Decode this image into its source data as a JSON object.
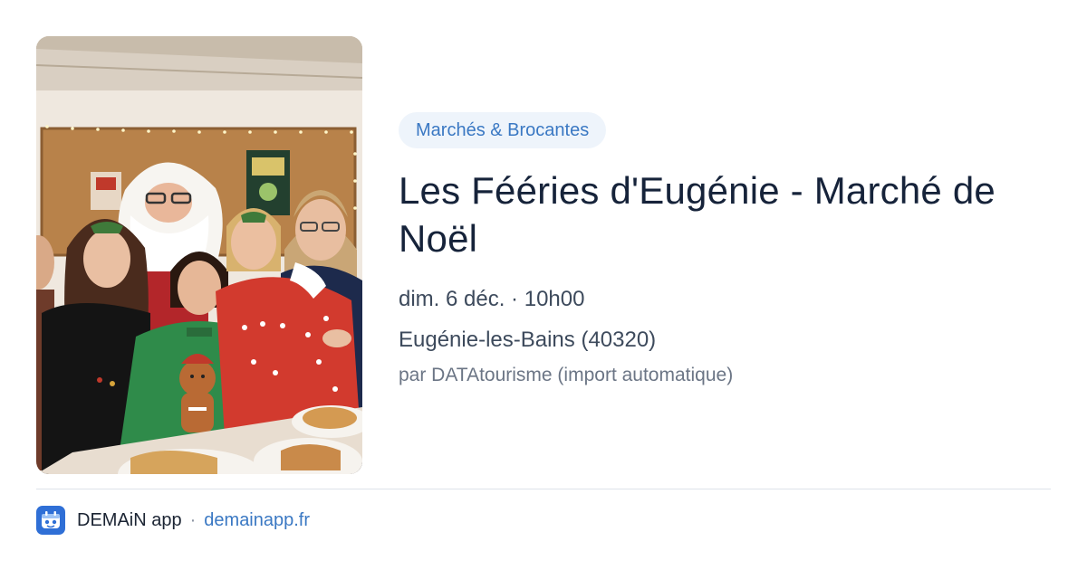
{
  "event": {
    "category": "Marchés & Brocantes",
    "title": "Les Fééries d'Eugénie - Marché de Noël",
    "date": "dim. 6 déc. · 10h00",
    "location": "Eugénie-les-Bains (40320)",
    "source": "par DATAtourisme (import automatique)",
    "photo_icon": "event-photo-christmas-market"
  },
  "footer": {
    "app_name": "DEMAiN app",
    "separator": "·",
    "app_url": "demainapp.fr",
    "app_icon": "demain-app-icon"
  },
  "colors": {
    "tag_background": "#eef4fb",
    "tag_text": "#3a78c3",
    "title": "#16233a",
    "link": "#3a78c3",
    "app_icon": "#2f6fd6"
  }
}
